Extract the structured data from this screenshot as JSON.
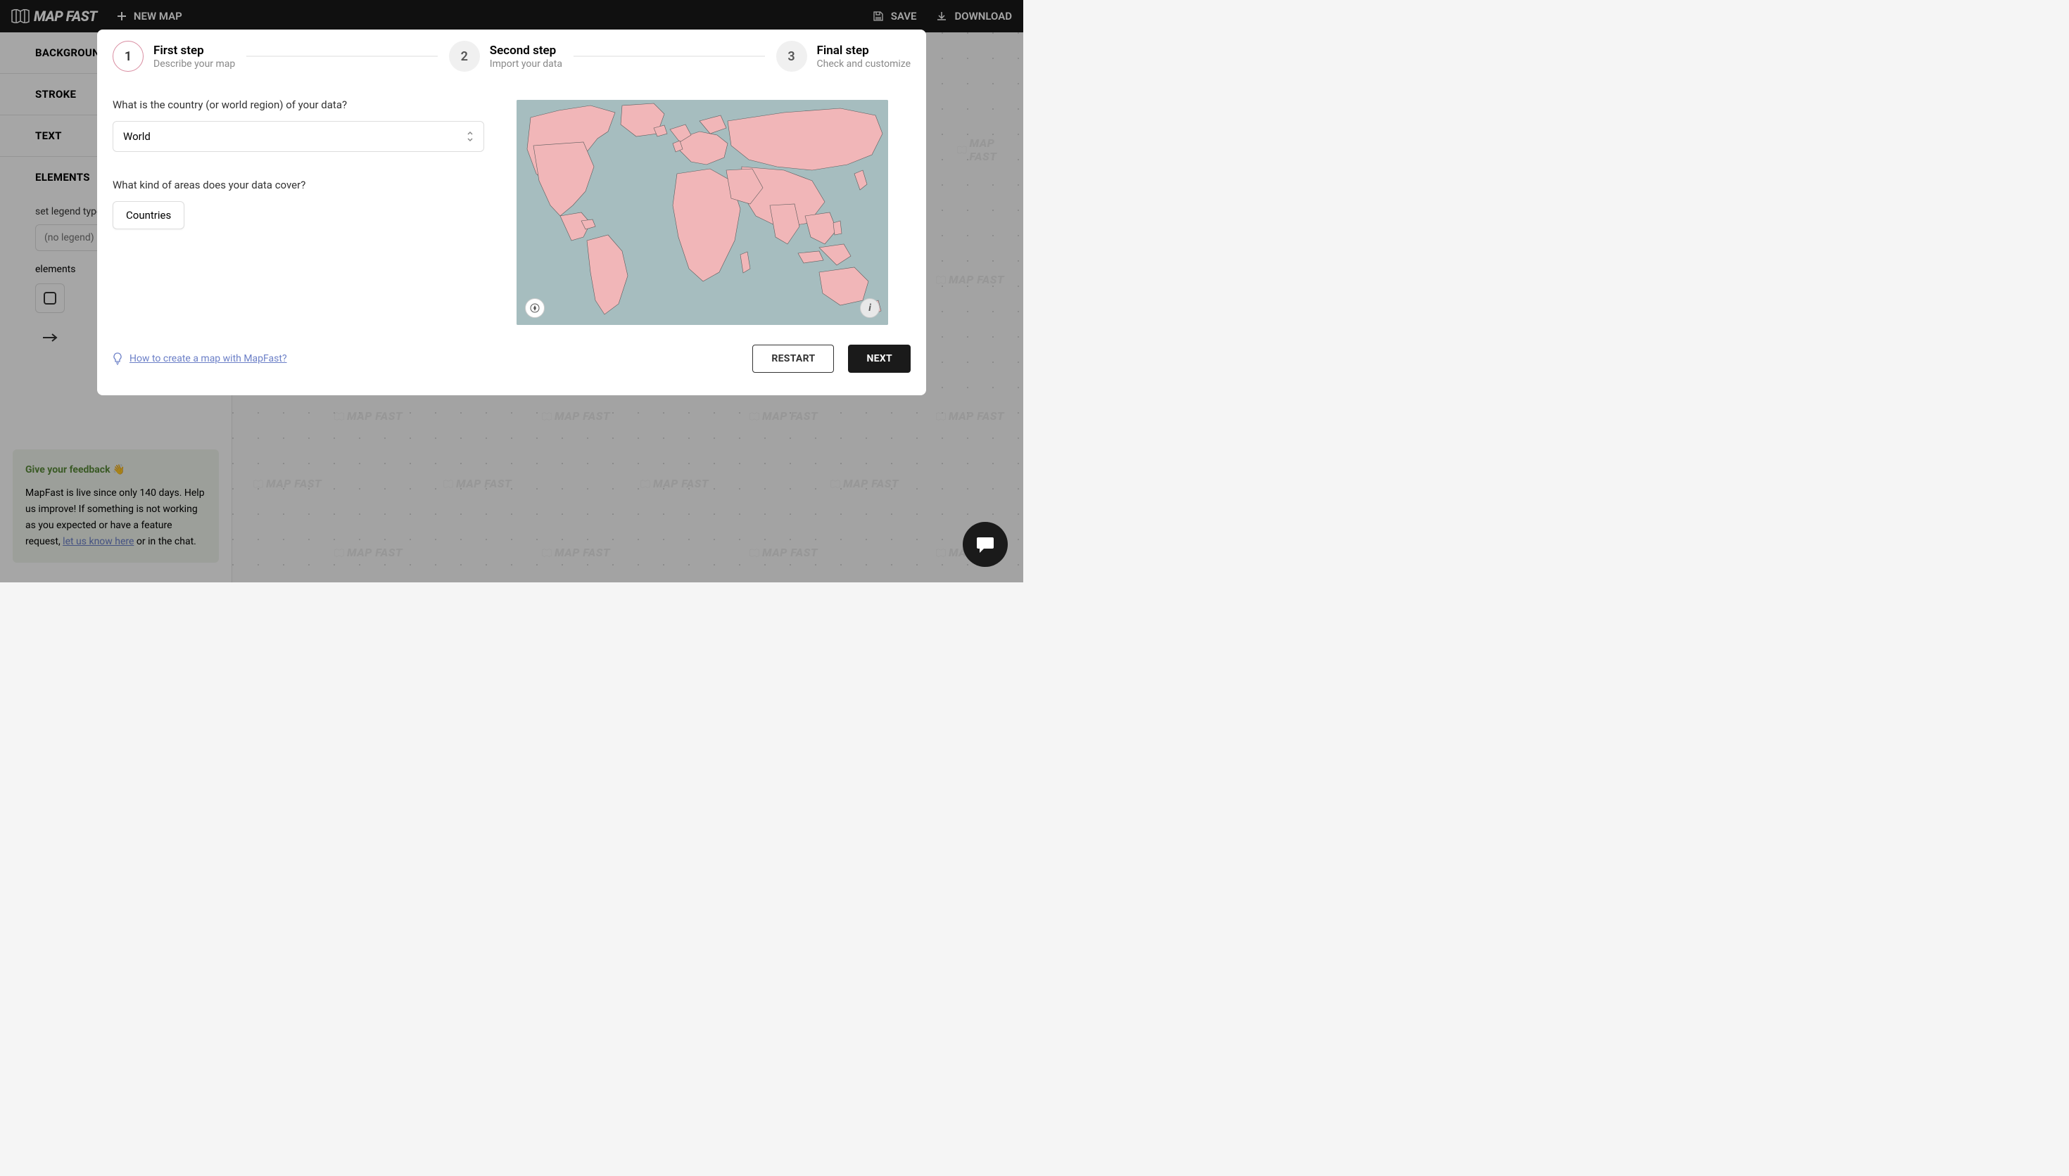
{
  "header": {
    "brand": "MAP FAST",
    "newMap": "NEW MAP",
    "save": "SAVE",
    "download": "DOWNLOAD"
  },
  "sidebar": {
    "sections": [
      "BACKGROUND",
      "STROKE",
      "TEXT",
      "ELEMENTS"
    ],
    "legendLabel": "set legend type",
    "legendPlaceholder": "(no legend)",
    "elementsLabel": "elements"
  },
  "feedback": {
    "title": "Give your feedback 👋",
    "text1": "MapFast is live since only 140 days. Help us improve! If something is not working as you expected or have a feature request, ",
    "linkText": "let us know here",
    "text2": " or in the chat."
  },
  "modal": {
    "steps": [
      {
        "num": "1",
        "title": "First step",
        "sub": "Describe your map"
      },
      {
        "num": "2",
        "title": "Second step",
        "sub": "Import your data"
      },
      {
        "num": "3",
        "title": "Final step",
        "sub": "Check and customize"
      }
    ],
    "q1": "What is the country (or world region) of your data?",
    "regionValue": "World",
    "q2": "What kind of areas does your data cover?",
    "areaOption": "Countries",
    "helpLink": "How to create a map with MapFast?",
    "restart": "RESTART",
    "next": "NEXT"
  },
  "watermark": "MAP FAST"
}
